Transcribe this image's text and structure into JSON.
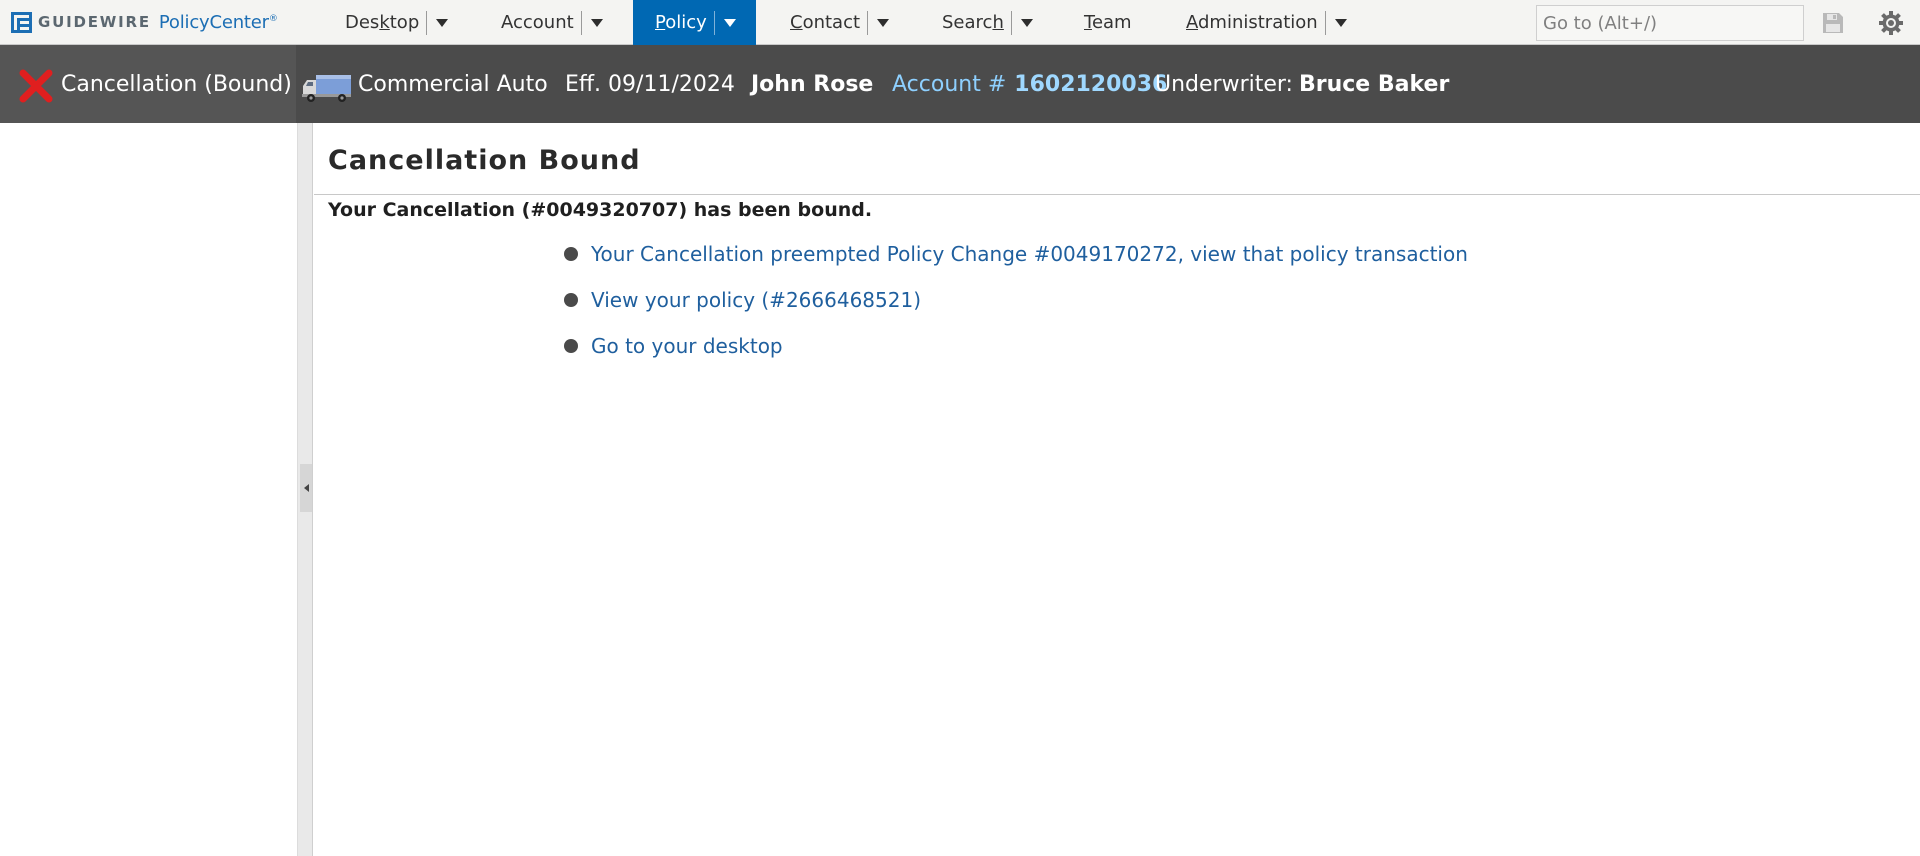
{
  "app": {
    "logo_brand": "GUIDEWIRE",
    "logo_product": "PolicyCenter",
    "logo_mark": "®"
  },
  "nav": {
    "items": [
      {
        "label_pre": "Des",
        "label_u": "k",
        "label_post": "top",
        "has_menu": true
      },
      {
        "label_pre": "Account",
        "label_u": "",
        "label_post": "",
        "has_menu": true
      },
      {
        "label_pre": "",
        "label_u": "P",
        "label_post": "olicy",
        "has_menu": true,
        "active": true
      },
      {
        "label_pre": "",
        "label_u": "C",
        "label_post": "ontact",
        "has_menu": true
      },
      {
        "label_pre": "Searc",
        "label_u": "h",
        "label_post": "",
        "has_menu": true
      },
      {
        "label_pre": "",
        "label_u": "T",
        "label_post": "eam",
        "has_menu": false
      },
      {
        "label_pre": "",
        "label_u": "A",
        "label_post": "dministration",
        "has_menu": true
      }
    ],
    "goto_placeholder": "Go to (Alt+/)"
  },
  "info": {
    "status": "Cancellation (Bound)",
    "product": "Commercial Auto",
    "effective": "Eff. 09/11/2024",
    "insured": "John Rose",
    "account_label": "Account #",
    "account_number": "1602120036",
    "underwriter_label": "Underwriter:",
    "underwriter_name": "Bruce Baker"
  },
  "main": {
    "title": "Cancellation Bound",
    "message": "Your Cancellation (#0049320707) has been bound.",
    "links": [
      "Your Cancellation preempted Policy Change #0049170272, view that policy transaction",
      "View your policy (#2666468521)",
      "Go to your desktop"
    ]
  },
  "colors": {
    "nav_active": "#0068b3",
    "info_bar": "#4b4b4b",
    "link": "#1f5f9e",
    "account_link": "#9fd8ff"
  }
}
